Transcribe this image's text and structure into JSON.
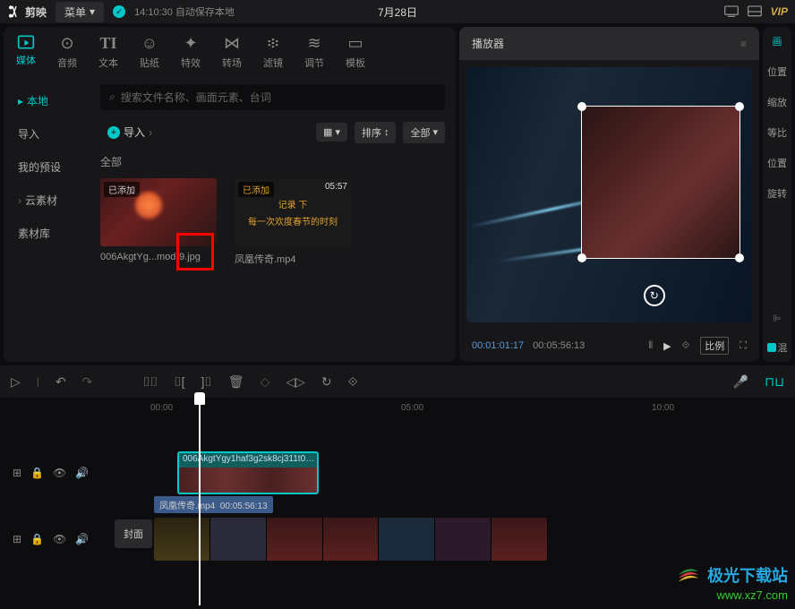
{
  "topbar": {
    "app_name": "剪映",
    "menu": "菜单",
    "autosave": "14:10:30 自动保存本地",
    "date": "7月28日",
    "vip": "VIP"
  },
  "tool_tabs": [
    {
      "icon": "▶",
      "label": "媒体",
      "active": true
    },
    {
      "icon": "♪",
      "label": "音频"
    },
    {
      "icon": "TI",
      "label": "文本"
    },
    {
      "icon": "☺",
      "label": "贴纸"
    },
    {
      "icon": "✦",
      "label": "特效"
    },
    {
      "icon": "⋈",
      "label": "转场"
    },
    {
      "icon": "◐",
      "label": "滤镜"
    },
    {
      "icon": "⚙",
      "label": "调节"
    },
    {
      "icon": "▭",
      "label": "模板"
    }
  ],
  "sidebar": [
    {
      "label": "本地",
      "active": true,
      "expand": true
    },
    {
      "label": "导入"
    },
    {
      "label": "我的预设"
    },
    {
      "label": "云素材",
      "expand": true
    },
    {
      "label": "素材库"
    }
  ],
  "search": {
    "placeholder": "搜索文件名称、画面元素、台词"
  },
  "actions": {
    "import": "导入",
    "sort": "排序",
    "all": "全部",
    "all_label": "全部"
  },
  "media_items": [
    {
      "tag": "已添加",
      "name": "006AkgtYg...mod·9.jpg"
    },
    {
      "tag": "已添加",
      "dur": "05:57",
      "line1": "记录 下",
      "line2": "每一次欢度春节的时刻",
      "name": "凤凰传奇.mp4"
    }
  ],
  "player": {
    "title": "播放器",
    "current": "00:01:01:17",
    "total": "00:05:56:13",
    "ratio": "比例"
  },
  "props": {
    "hdr": "画",
    "items": [
      "位置",
      "缩放",
      "等比",
      "位置",
      "旋转"
    ],
    "mix": "混"
  },
  "ruler": [
    "00:00",
    "05:00",
    "10:00"
  ],
  "clips": {
    "c1": "006AkgtYgy1haf3g2sk8cj311t0…",
    "c2_name": "凤凰传奇.mp4",
    "c2_dur": "00:05:56:13",
    "cover": "封面"
  },
  "watermark": {
    "name": "极光下载站",
    "url": "www.xz7.com"
  }
}
